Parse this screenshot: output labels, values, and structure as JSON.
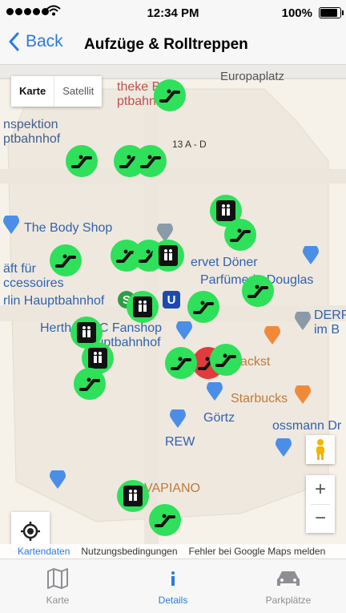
{
  "status": {
    "time": "12:34 PM",
    "battery": "100%",
    "battery_level": 1.0
  },
  "nav": {
    "back_label": "Back",
    "title": "Aufzüge & Rolltreppen"
  },
  "map": {
    "type_controls": {
      "map": "Karte",
      "satellite": "Satellit"
    },
    "labels": {
      "europaplatz": "Europaplatz",
      "bibliothek": "theke Berl",
      "hbf1": "ptbahnhof",
      "inspektion": "nspektion",
      "hbf2": "ptbahnhof",
      "platform": "13 A - D",
      "body_shop": "The Body Shop",
      "kraft": "äft für",
      "accessoires": "ccessoires",
      "berlin_hbf": "rlin Hauptbahnhof",
      "doner": "ervet Döner",
      "douglas": "Parfümerie Douglas",
      "hertha": "Hertha BSC Fanshop",
      "hbf3": "Hauptbahnhof",
      "derp": "DERP",
      "imb": "im B",
      "backst": "ackst",
      "starbucks": "Starbucks",
      "goertz": "Görtz",
      "rewe": "REW",
      "rossmann": "ossmann Dr",
      "vapiano": "VAPIANO"
    },
    "attribution": {
      "data": "Kartendaten",
      "terms": "Nutzungsbedingungen",
      "report": "Fehler bei Google Maps melden"
    }
  },
  "markers": [
    {
      "kind": "escalator",
      "color": "#2ee05a"
    },
    {
      "kind": "escalator",
      "color": "#2ee05a"
    },
    {
      "kind": "escalator",
      "color": "#2ee05a"
    },
    {
      "kind": "escalator",
      "color": "#2ee05a"
    },
    {
      "kind": "elevator",
      "color": "#2ee05a"
    },
    {
      "kind": "escalator",
      "color": "#2ee05a"
    },
    {
      "kind": "escalator",
      "color": "#2ee05a"
    },
    {
      "kind": "escalator",
      "color": "#2ee05a"
    },
    {
      "kind": "elevator",
      "color": "#2ee05a"
    },
    {
      "kind": "elevator",
      "color": "#2ee05a"
    },
    {
      "kind": "escalator",
      "color": "#2ee05a"
    },
    {
      "kind": "escalator",
      "color": "#2ee05a"
    },
    {
      "kind": "elevator",
      "color": "#2ee05a"
    },
    {
      "kind": "escalator",
      "color": "#2ee05a"
    },
    {
      "kind": "elevator",
      "color": "#2ee05a"
    },
    {
      "kind": "escalator",
      "color": "#2ee05a"
    },
    {
      "kind": "escalator",
      "color": "#e23b3b"
    },
    {
      "kind": "escalator",
      "color": "#2ee05a"
    },
    {
      "kind": "escalator",
      "color": "#2ee05a"
    },
    {
      "kind": "elevator",
      "color": "#2ee05a"
    },
    {
      "kind": "escalator",
      "color": "#2ee05a"
    }
  ],
  "tabs": [
    {
      "label": "Karte",
      "icon": "map-icon",
      "active": false
    },
    {
      "label": "Details",
      "icon": "info-icon",
      "active": true
    },
    {
      "label": "Parkplätze",
      "icon": "car-icon",
      "active": false
    }
  ],
  "colors": {
    "accent": "#2a7ae2",
    "marker_ok": "#2ee05a",
    "marker_broken": "#e23b3b"
  }
}
